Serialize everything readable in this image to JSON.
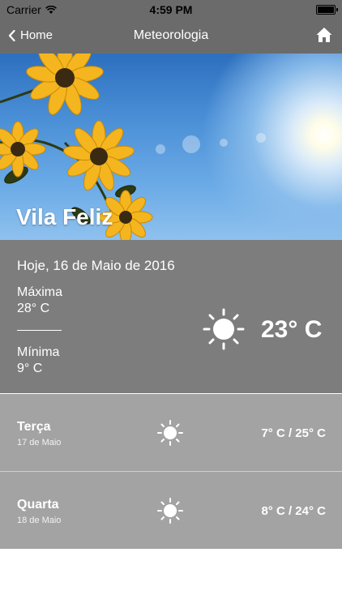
{
  "status_bar": {
    "carrier": "Carrier",
    "time": "4:59 PM"
  },
  "navbar": {
    "back_label": "Home",
    "title": "Meteorologia",
    "home_icon": "home-icon"
  },
  "hero": {
    "city": "Vila Feliz"
  },
  "today": {
    "date_label": "Hoje, 16 de Maio de 2016",
    "max_label": "Máxima",
    "max_value": "28° C",
    "min_label": "Mínima",
    "min_value": "9° C",
    "current_temp": "23° C",
    "icon": "sun-icon"
  },
  "forecast": [
    {
      "day": "Terça",
      "date": "17 de Maio",
      "temps": "7° C / 25° C",
      "icon": "sun-icon"
    },
    {
      "day": "Quarta",
      "date": "18 de Maio",
      "temps": "8° C / 24° C",
      "icon": "sun-icon"
    }
  ],
  "colors": {
    "bar": "#6b6b6b",
    "today_bg": "#7d7d7d",
    "forecast_bg": "#a3a3a3"
  }
}
